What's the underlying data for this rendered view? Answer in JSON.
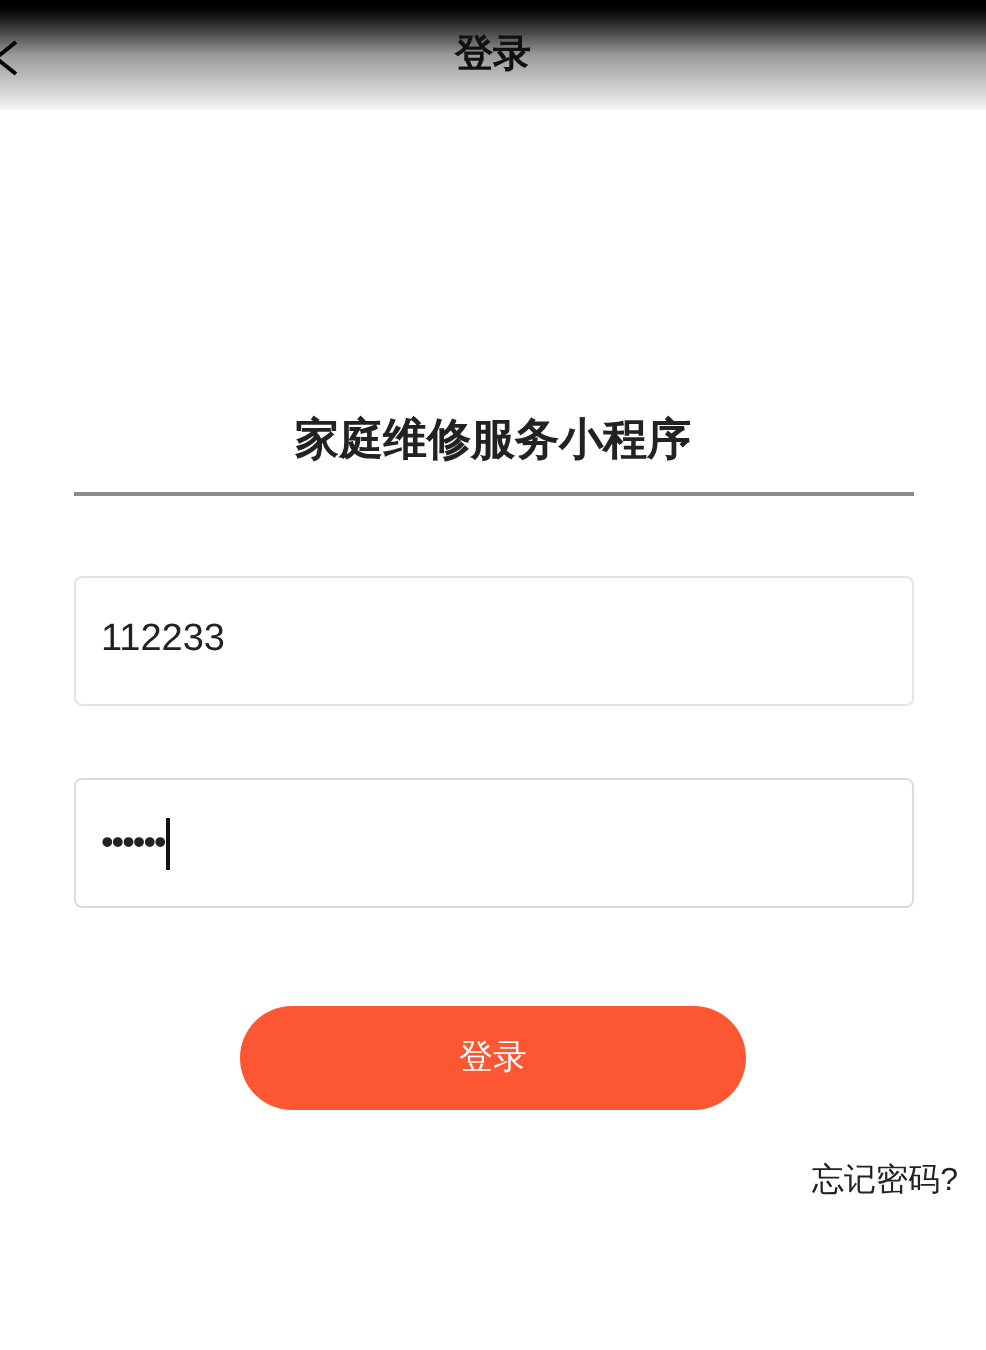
{
  "header": {
    "title": "登录"
  },
  "app_title": "家庭维修服务小程序",
  "fields": [
    {
      "kind": "text",
      "value": "112233",
      "focused": false
    },
    {
      "kind": "password",
      "value": "••••••",
      "focused": true
    }
  ],
  "login_button": "登录",
  "forgot_link": "忘记密码?"
}
